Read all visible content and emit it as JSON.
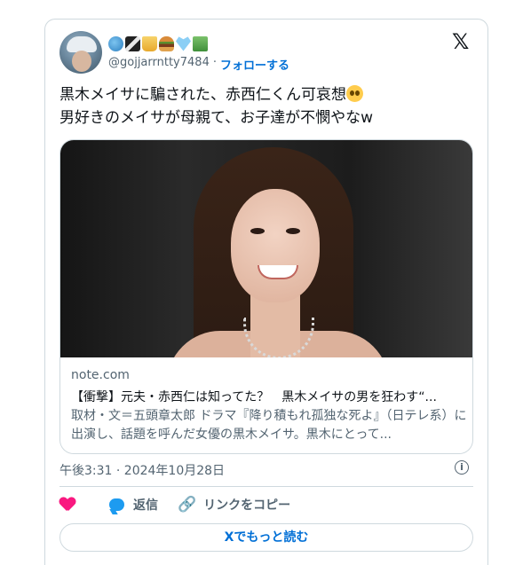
{
  "author": {
    "emoji_icons": [
      "globe-icon",
      "clapper-board-icon",
      "beer-icon",
      "hamburger-icon",
      "blue-heart-icon",
      "money-icon"
    ],
    "handle": "@gojjarrntty7484",
    "separator": "·",
    "follow_label": "フォローする"
  },
  "tweet": {
    "line1": "黒木メイサに騙された、赤西仁くん可哀想",
    "line2": "男好きのメイサが母親て、お子達が不憫やなw",
    "emoji": "pleading-face-icon"
  },
  "link_card": {
    "domain": "note.com",
    "title": "【衝撃】元夫・赤西仁は知ってた？　黒木メイサの男を狂わす“...",
    "description": "取材・文＝五頭章太郎 ドラマ『降り積もれ孤独な死よ』（日テレ系）に出演し、話題を呼んだ女優の黒木メイサ。黒木にとって..."
  },
  "timestamp": "午後3:31 · 2024年10月28日",
  "actions": {
    "reply_label": "返信",
    "copy_link_label": "リンクをコピー"
  },
  "read_more_label": "Xでもっと読む",
  "colors": {
    "accent": "#006fd6",
    "like": "#f91880",
    "muted": "#536471",
    "border": "#cfd9de"
  }
}
